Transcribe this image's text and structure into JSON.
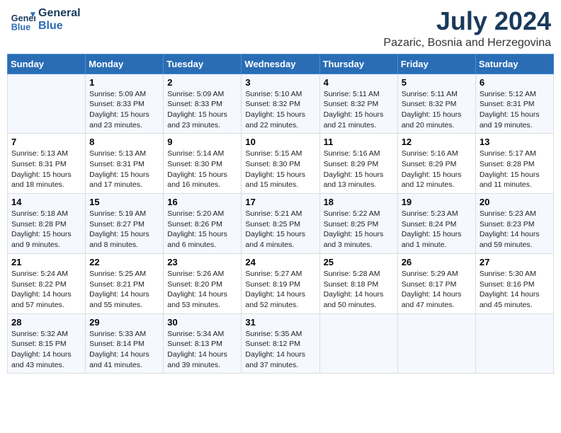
{
  "logo": {
    "line1": "General",
    "line2": "Blue"
  },
  "title": "July 2024",
  "location": "Pazaric, Bosnia and Herzegovina",
  "weekdays": [
    "Sunday",
    "Monday",
    "Tuesday",
    "Wednesday",
    "Thursday",
    "Friday",
    "Saturday"
  ],
  "weeks": [
    [
      null,
      {
        "day": "1",
        "sunrise": "5:09 AM",
        "sunset": "8:33 PM",
        "daylight": "15 hours and 23 minutes."
      },
      {
        "day": "2",
        "sunrise": "5:09 AM",
        "sunset": "8:33 PM",
        "daylight": "15 hours and 23 minutes."
      },
      {
        "day": "3",
        "sunrise": "5:10 AM",
        "sunset": "8:32 PM",
        "daylight": "15 hours and 22 minutes."
      },
      {
        "day": "4",
        "sunrise": "5:11 AM",
        "sunset": "8:32 PM",
        "daylight": "15 hours and 21 minutes."
      },
      {
        "day": "5",
        "sunrise": "5:11 AM",
        "sunset": "8:32 PM",
        "daylight": "15 hours and 20 minutes."
      },
      {
        "day": "6",
        "sunrise": "5:12 AM",
        "sunset": "8:31 PM",
        "daylight": "15 hours and 19 minutes."
      }
    ],
    [
      {
        "day": "7",
        "sunrise": "5:13 AM",
        "sunset": "8:31 PM",
        "daylight": "15 hours and 18 minutes."
      },
      {
        "day": "8",
        "sunrise": "5:13 AM",
        "sunset": "8:31 PM",
        "daylight": "15 hours and 17 minutes."
      },
      {
        "day": "9",
        "sunrise": "5:14 AM",
        "sunset": "8:30 PM",
        "daylight": "15 hours and 16 minutes."
      },
      {
        "day": "10",
        "sunrise": "5:15 AM",
        "sunset": "8:30 PM",
        "daylight": "15 hours and 15 minutes."
      },
      {
        "day": "11",
        "sunrise": "5:16 AM",
        "sunset": "8:29 PM",
        "daylight": "15 hours and 13 minutes."
      },
      {
        "day": "12",
        "sunrise": "5:16 AM",
        "sunset": "8:29 PM",
        "daylight": "15 hours and 12 minutes."
      },
      {
        "day": "13",
        "sunrise": "5:17 AM",
        "sunset": "8:28 PM",
        "daylight": "15 hours and 11 minutes."
      }
    ],
    [
      {
        "day": "14",
        "sunrise": "5:18 AM",
        "sunset": "8:28 PM",
        "daylight": "15 hours and 9 minutes."
      },
      {
        "day": "15",
        "sunrise": "5:19 AM",
        "sunset": "8:27 PM",
        "daylight": "15 hours and 8 minutes."
      },
      {
        "day": "16",
        "sunrise": "5:20 AM",
        "sunset": "8:26 PM",
        "daylight": "15 hours and 6 minutes."
      },
      {
        "day": "17",
        "sunrise": "5:21 AM",
        "sunset": "8:25 PM",
        "daylight": "15 hours and 4 minutes."
      },
      {
        "day": "18",
        "sunrise": "5:22 AM",
        "sunset": "8:25 PM",
        "daylight": "15 hours and 3 minutes."
      },
      {
        "day": "19",
        "sunrise": "5:23 AM",
        "sunset": "8:24 PM",
        "daylight": "15 hours and 1 minute."
      },
      {
        "day": "20",
        "sunrise": "5:23 AM",
        "sunset": "8:23 PM",
        "daylight": "14 hours and 59 minutes."
      }
    ],
    [
      {
        "day": "21",
        "sunrise": "5:24 AM",
        "sunset": "8:22 PM",
        "daylight": "14 hours and 57 minutes."
      },
      {
        "day": "22",
        "sunrise": "5:25 AM",
        "sunset": "8:21 PM",
        "daylight": "14 hours and 55 minutes."
      },
      {
        "day": "23",
        "sunrise": "5:26 AM",
        "sunset": "8:20 PM",
        "daylight": "14 hours and 53 minutes."
      },
      {
        "day": "24",
        "sunrise": "5:27 AM",
        "sunset": "8:19 PM",
        "daylight": "14 hours and 52 minutes."
      },
      {
        "day": "25",
        "sunrise": "5:28 AM",
        "sunset": "8:18 PM",
        "daylight": "14 hours and 50 minutes."
      },
      {
        "day": "26",
        "sunrise": "5:29 AM",
        "sunset": "8:17 PM",
        "daylight": "14 hours and 47 minutes."
      },
      {
        "day": "27",
        "sunrise": "5:30 AM",
        "sunset": "8:16 PM",
        "daylight": "14 hours and 45 minutes."
      }
    ],
    [
      {
        "day": "28",
        "sunrise": "5:32 AM",
        "sunset": "8:15 PM",
        "daylight": "14 hours and 43 minutes."
      },
      {
        "day": "29",
        "sunrise": "5:33 AM",
        "sunset": "8:14 PM",
        "daylight": "14 hours and 41 minutes."
      },
      {
        "day": "30",
        "sunrise": "5:34 AM",
        "sunset": "8:13 PM",
        "daylight": "14 hours and 39 minutes."
      },
      {
        "day": "31",
        "sunrise": "5:35 AM",
        "sunset": "8:12 PM",
        "daylight": "14 hours and 37 minutes."
      },
      null,
      null,
      null
    ]
  ]
}
